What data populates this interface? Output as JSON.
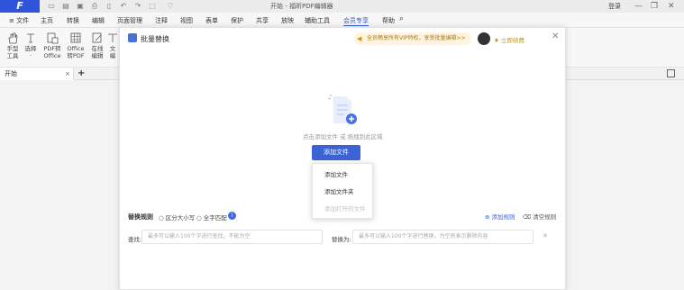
{
  "app": {
    "logo": "F",
    "window_title": "开始 - 福昕PDF编辑器",
    "login": "登录"
  },
  "menu": [
    "文件",
    "主页",
    "转换",
    "编辑",
    "页面管理",
    "注释",
    "视图",
    "表单",
    "保护",
    "共享",
    "放映",
    "辅助工具",
    "会员专享",
    "帮助"
  ],
  "toolbar": [
    {
      "icon": "hand-icon",
      "label": "手型\n工具"
    },
    {
      "icon": "select-icon",
      "label": "选择\n·"
    },
    {
      "icon": "pdf-to-office-icon",
      "label": "PDF转\nOffice"
    },
    {
      "icon": "office-to-pdf-icon",
      "label": "Office\n转PDF"
    },
    {
      "icon": "edit-online-icon",
      "label": "在线\n编辑"
    },
    {
      "icon": "text-edit-icon",
      "label": "文\n编"
    }
  ],
  "tabs": {
    "start": "开始",
    "close": "×",
    "add": "+"
  },
  "dialog": {
    "title": "批量替换",
    "vip_banner": "全员畅享所有VIP特权，享受批量编辑>>",
    "vip_open": "立即续费",
    "drop_hint": "点击添加文件 或 拖拽到此区域",
    "add_file": "添加文件",
    "dropdown": [
      {
        "label": "添加文件",
        "enabled": true
      },
      {
        "label": "添加文件夹",
        "enabled": true
      },
      {
        "label": "添加打开的文件",
        "enabled": false
      }
    ],
    "rule_label": "替换规则",
    "case_option": "区分大小写",
    "whole_word_option": "全字匹配",
    "info_glyph": "i",
    "add_rule": "添加规则",
    "clear_rules": "清空规则",
    "find_label": "查找:",
    "find_placeholder": "最多可以输入100个字进行查找，不能为空",
    "replace_label": "替换为:",
    "replace_placeholder": "最多可以输入100个字进行替换，为空则表示删除内容"
  },
  "colors": {
    "brand": "#2f54d9",
    "primary_button": "#3b63d6",
    "vip_gold": "#c8941d"
  }
}
